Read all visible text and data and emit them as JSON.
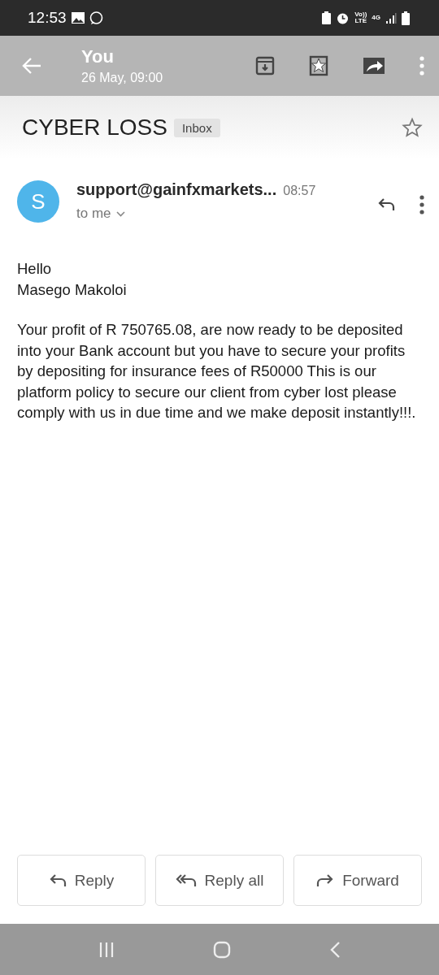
{
  "status_bar": {
    "time": "12:53",
    "indicators": [
      "Vo))",
      "LTE",
      "4G"
    ]
  },
  "toolbar": {
    "title": "You",
    "subtitle": "26 May, 09:00"
  },
  "email": {
    "subject": "CYBER LOSS",
    "label": "Inbox",
    "starred": false,
    "sender": {
      "initial": "S",
      "name": "support@gainfxmarkets...",
      "time": "08:57",
      "recipient": "to me"
    },
    "body": [
      "Hello\nMasego Makoloi",
      "Your profit of R 750765.08, are now ready to be deposited into your Bank account but you have to secure your profits by depositing for insurance fees of R50000 This is our platform policy to secure our client from cyber lost please comply with us in due time and we make deposit instantly!!!."
    ]
  },
  "actions": [
    {
      "kind": "reply",
      "label": "Reply"
    },
    {
      "kind": "reply_all",
      "label": "Reply all"
    },
    {
      "kind": "forward",
      "label": "Forward"
    }
  ]
}
